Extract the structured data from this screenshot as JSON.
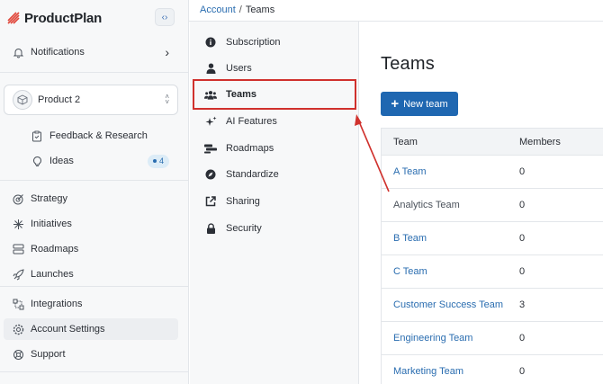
{
  "app": {
    "name": "ProductPlan"
  },
  "sidebar": {
    "notifications_label": "Notifications",
    "product": {
      "name": "Product 2"
    },
    "product_items": [
      {
        "label": "Feedback & Research"
      },
      {
        "label": "Ideas",
        "badge": "4"
      }
    ],
    "nav": [
      {
        "label": "Strategy"
      },
      {
        "label": "Initiatives"
      },
      {
        "label": "Roadmaps"
      },
      {
        "label": "Launches"
      },
      {
        "label": "Integrations"
      },
      {
        "label": "Account Settings",
        "active": true
      },
      {
        "label": "Support"
      }
    ]
  },
  "breadcrumb": {
    "parent": "Account",
    "separator": "/",
    "current": "Teams"
  },
  "settings_menu": {
    "items": [
      {
        "label": "Subscription",
        "icon": "info-icon"
      },
      {
        "label": "Users",
        "icon": "user-icon"
      },
      {
        "label": "Teams",
        "icon": "users-icon",
        "active": true
      },
      {
        "label": "AI Features",
        "icon": "sparkle-icon"
      },
      {
        "label": "Roadmaps",
        "icon": "roadmap-icon"
      },
      {
        "label": "Standardize",
        "icon": "compass-icon"
      },
      {
        "label": "Sharing",
        "icon": "share-icon"
      },
      {
        "label": "Security",
        "icon": "lock-icon"
      }
    ]
  },
  "main": {
    "title": "Teams",
    "new_team_label": "New team",
    "table": {
      "headers": {
        "team": "Team",
        "members": "Members"
      },
      "rows": [
        {
          "team": "A Team",
          "members": "0",
          "link": true
        },
        {
          "team": "Analytics Team",
          "members": "0",
          "link": false
        },
        {
          "team": "B Team",
          "members": "0",
          "link": true
        },
        {
          "team": "C Team",
          "members": "0",
          "link": true
        },
        {
          "team": "Customer Success Team",
          "members": "3",
          "link": true
        },
        {
          "team": "Engineering Team",
          "members": "0",
          "link": true
        },
        {
          "team": "Marketing Team",
          "members": "0",
          "link": true
        }
      ]
    }
  },
  "colors": {
    "accent": "#1f67b1",
    "link": "#2a6db0",
    "annotation": "#d0312d",
    "sidebar_bg": "#f7f8f9"
  }
}
